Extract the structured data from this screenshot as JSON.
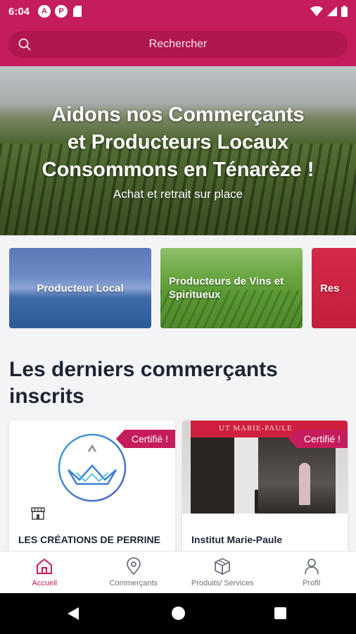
{
  "status_bar": {
    "time": "6:04",
    "notification_icons": [
      "A",
      "P"
    ]
  },
  "header": {
    "search_placeholder": "Rechercher"
  },
  "hero": {
    "title": "Aidons nos Commerçants\net Producteurs Locaux\nConsommons en Ténarèze !",
    "subtitle": "Achat et retrait sur place"
  },
  "categories": [
    {
      "label": "Producteur Local"
    },
    {
      "label": "Producteurs de Vins et Spiritueux"
    },
    {
      "label": "Res"
    }
  ],
  "section": {
    "title": "Les derniers commerçants inscrits"
  },
  "merchants": [
    {
      "badge": "Certifié !",
      "name": "LES CRÉATIONS DE PERRINE"
    },
    {
      "badge": "Certifié !",
      "name": "Institut Marie-Paule",
      "sign_text": "UT MARIE-PAULE"
    }
  ],
  "bottom_nav": [
    {
      "label": "Accueil",
      "icon": "home-icon",
      "active": true
    },
    {
      "label": "Commerçants",
      "icon": "map-pin-icon",
      "active": false
    },
    {
      "label": "Produits/ Services",
      "icon": "package-icon",
      "active": false
    },
    {
      "label": "Profil",
      "icon": "user-icon",
      "active": false
    }
  ],
  "colors": {
    "primary": "#c51c5e",
    "text_dark": "#1d2433"
  }
}
